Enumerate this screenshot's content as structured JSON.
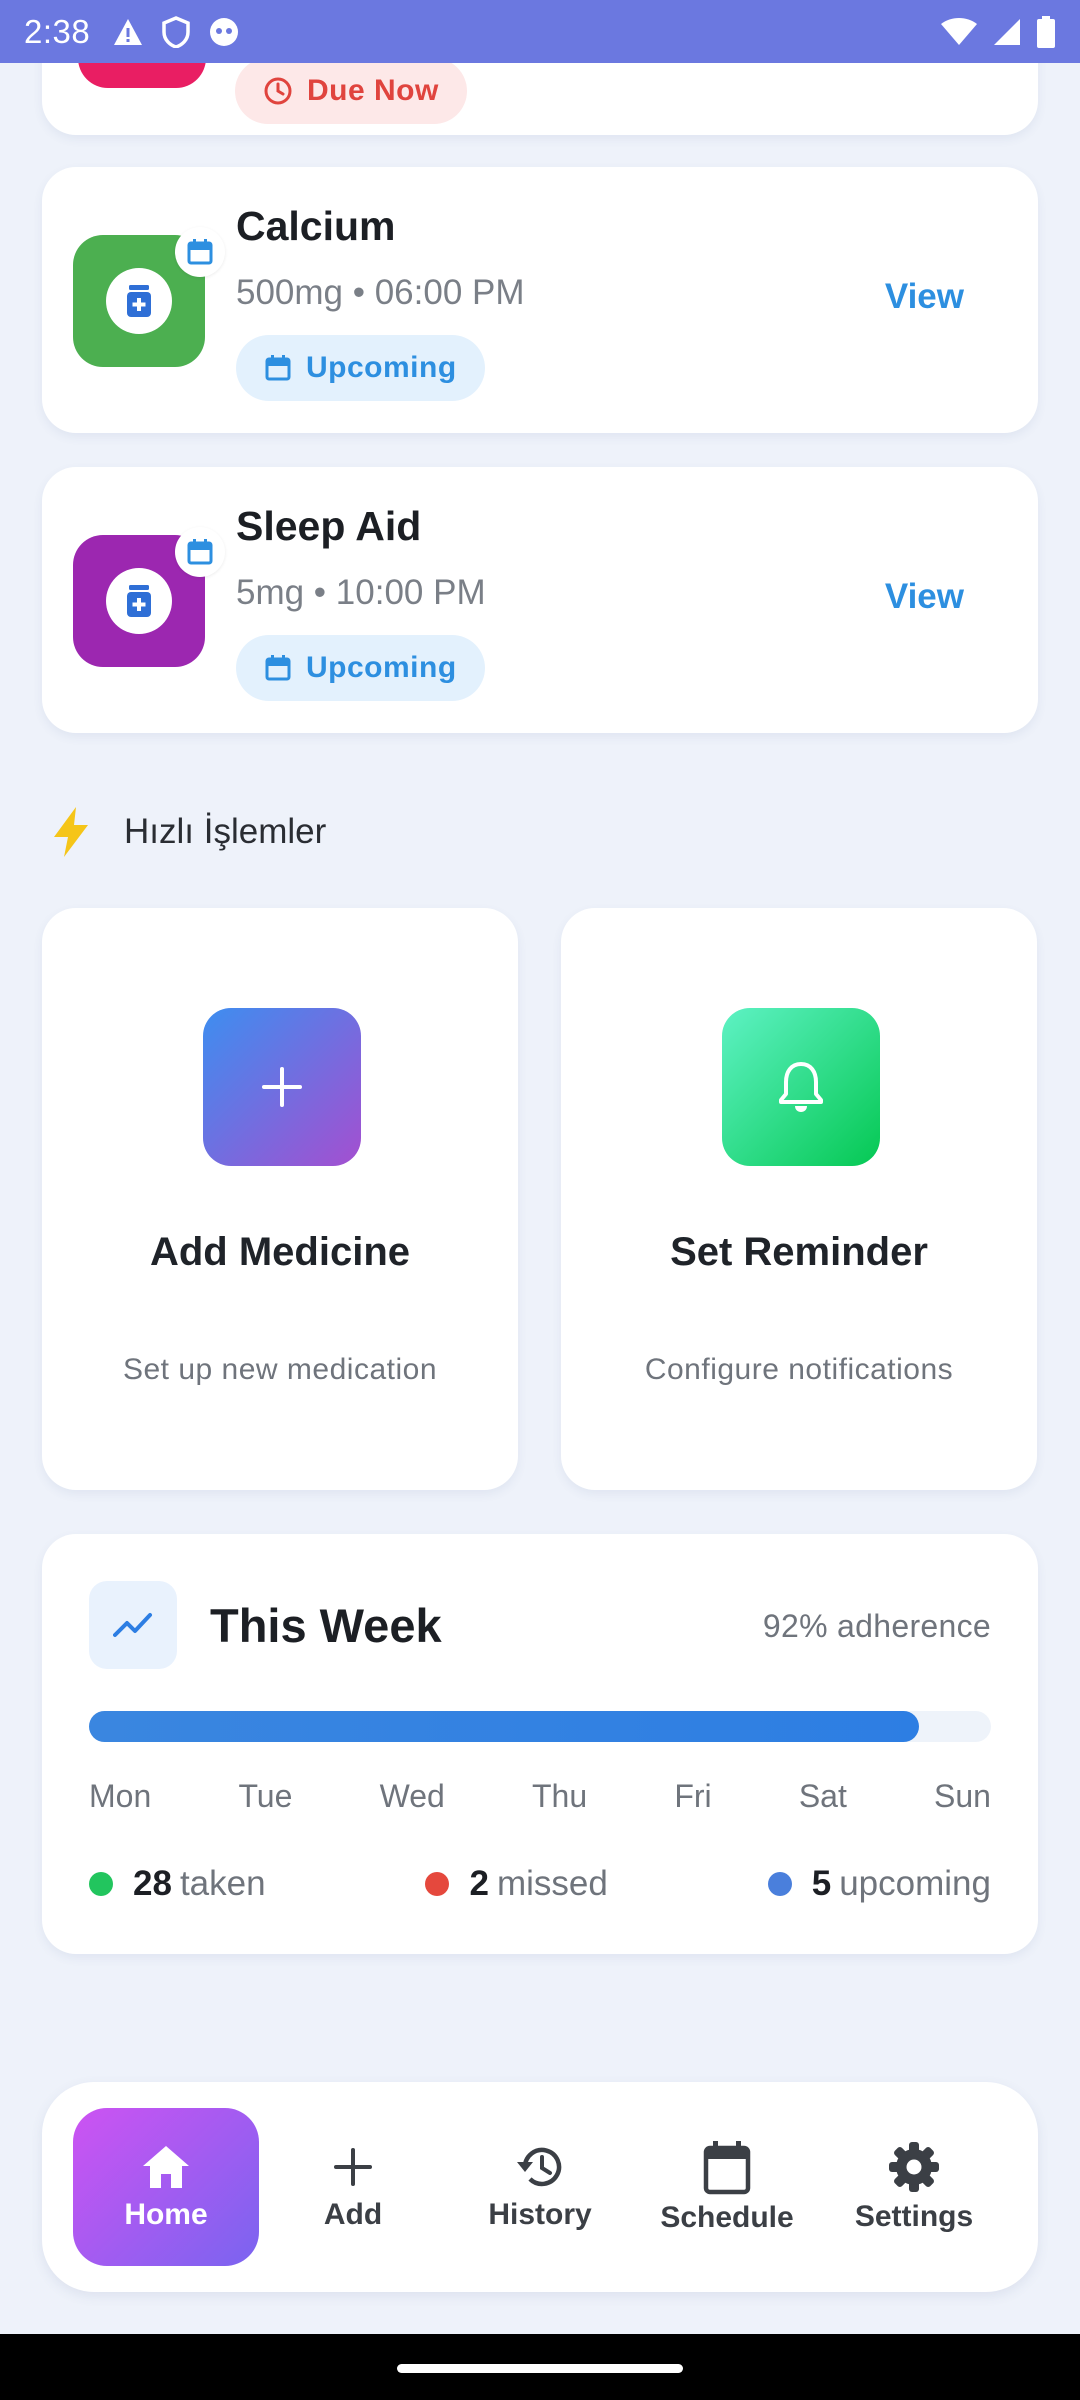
{
  "status_bar": {
    "time": "2:38"
  },
  "top_card": {
    "badge": "Due Now"
  },
  "medicines": [
    {
      "name": "Calcium",
      "dose": "500mg • 06:00 PM",
      "status": "Upcoming",
      "action": "View",
      "color": "#4caf50"
    },
    {
      "name": "Sleep Aid",
      "dose": "5mg • 10:00 PM",
      "status": "Upcoming",
      "action": "View",
      "color": "#9c27b0"
    }
  ],
  "quick_actions": {
    "heading": "Hızlı İşlemler",
    "items": [
      {
        "title": "Add Medicine",
        "subtitle": "Set up new medication"
      },
      {
        "title": "Set Reminder",
        "subtitle": "Configure notifications"
      }
    ]
  },
  "week": {
    "title": "This Week",
    "adherence": "92% adherence",
    "progress": 0.92,
    "days": [
      "Mon",
      "Tue",
      "Wed",
      "Thu",
      "Fri",
      "Sat",
      "Sun"
    ],
    "stats": [
      {
        "count": "28",
        "label": "taken",
        "color": "#22c55e"
      },
      {
        "count": "2",
        "label": "missed",
        "color": "#e5483d"
      },
      {
        "count": "5",
        "label": "upcoming",
        "color": "#4a7fdc"
      }
    ]
  },
  "nav": {
    "items": [
      {
        "label": "Home",
        "icon": "home-icon",
        "active": true
      },
      {
        "label": "Add",
        "icon": "plus-icon"
      },
      {
        "label": "History",
        "icon": "history-icon"
      },
      {
        "label": "Schedule",
        "icon": "calendar-icon"
      },
      {
        "label": "Settings",
        "icon": "gear-icon"
      }
    ]
  }
}
